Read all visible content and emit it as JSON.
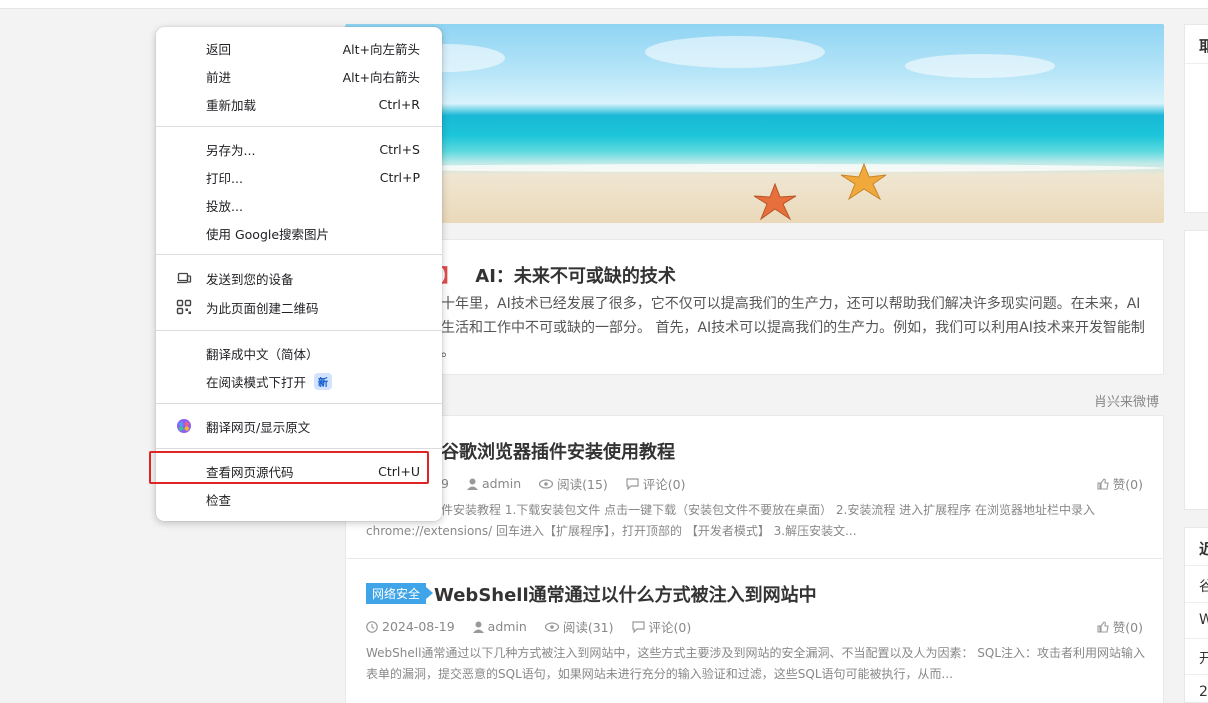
{
  "context_menu": {
    "items": [
      {
        "label": "返回",
        "shortcut": "Alt+向左箭头"
      },
      {
        "label": "前进",
        "shortcut": "Alt+向右箭头"
      },
      {
        "label": "重新加载",
        "shortcut": "Ctrl+R"
      },
      {
        "label": "另存为...",
        "shortcut": "Ctrl+S"
      },
      {
        "label": "打印...",
        "shortcut": "Ctrl+P"
      },
      {
        "label": "投放..."
      },
      {
        "label": "使用 Google搜索图片"
      },
      {
        "label": "发送到您的设备",
        "icon": "device-icon"
      },
      {
        "label": "为此页面创建二维码",
        "icon": "qr-code-icon"
      },
      {
        "label": "翻译成中文（简体）"
      },
      {
        "label": "在阅读模式下打开",
        "badge": "新"
      },
      {
        "label": "翻译网页/显示原文",
        "icon": "translate-extension-icon"
      },
      {
        "label": "查看网页源代码",
        "shortcut": "Ctrl+U"
      },
      {
        "label": "检查"
      }
    ]
  },
  "featured": {
    "title_tag": "】",
    "title": "AI：未来不可或缺的技术",
    "excerpt_line1": "十年里，AI技术已经发展了很多，它不仅可以提高我们的生产力，还可以帮助我们解决许多现实问题。在未来，AI",
    "excerpt_line2": "生活和工作中不可或缺的一部分。 首先，AI技术可以提高我们的生产力。例如，我们可以利用AI技术来开发智能制",
    "excerpt_line3": "。"
  },
  "weibo_link": "肖兴来微博",
  "posts": [
    {
      "title": "谷歌浏览器插件安装使用教程",
      "date": "9",
      "author": "admin",
      "views": "阅读(15)",
      "comments": "评论(0)",
      "likes": "赞(0)",
      "excerpt_line1": "件安装教程 1.下载安装包文件 点击一键下载（安装包文件不要放在桌面） 2.安装流程 进入扩展程序 在浏览器地址栏中录入",
      "excerpt_line2": "chrome://extensions/ 回车进入【扩展程序】，打开顶部的 【开发者模式】 3.解压安装文..."
    },
    {
      "category": "网络安全",
      "title": "WebShell通常通过以什么方式被注入到网站中",
      "date": "2024-08-19",
      "author": "admin",
      "views": "阅读(31)",
      "comments": "评论(0)",
      "likes": "赞(0)",
      "excerpt_line1": "WebShell通常通过以下几种方式被注入到网站中，这些方式主要涉及到网站的安全漏洞、不当配置以及人为因素： SQL注入：攻击者利用网站输入",
      "excerpt_line2": "表单的漏洞，提交恶意的SQL语句，如果网站未进行充分的输入验证和过滤，这些SQL语句可能被执行，从而..."
    }
  ],
  "sidebar": {
    "box1_title": "耶",
    "box3_title": "近",
    "box3_items": [
      "谷",
      "W",
      "开",
      "2"
    ]
  },
  "colors": {
    "highlight": "#e02424",
    "category": "#3fa4e8",
    "tag_red": "#e14d4d"
  }
}
